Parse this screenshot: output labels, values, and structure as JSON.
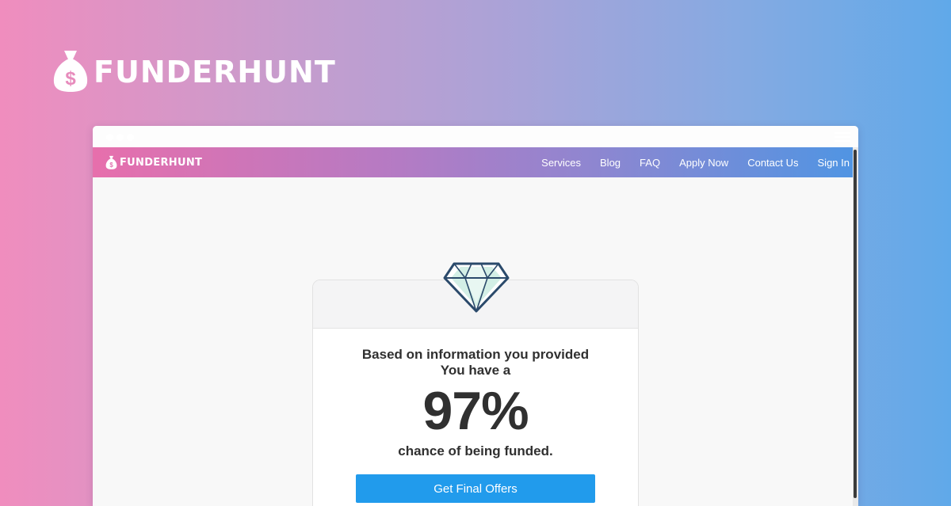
{
  "brand": {
    "name": "FUNDERHUNT"
  },
  "navbar": {
    "logo_text": "FUNDERHUNT",
    "links": [
      "Services",
      "Blog",
      "FAQ",
      "Apply Now",
      "Contact Us",
      "Sign In"
    ]
  },
  "result_card": {
    "line1": "Based on information you provided",
    "line2": "You have a",
    "percent": "97%",
    "caption": "chance of being funded.",
    "cta_label": "Get Final Offers",
    "icon": "diamond-icon"
  },
  "colors": {
    "cta": "#219bec",
    "gradient_start": "#f08dbe",
    "gradient_end": "#60a9e9"
  }
}
